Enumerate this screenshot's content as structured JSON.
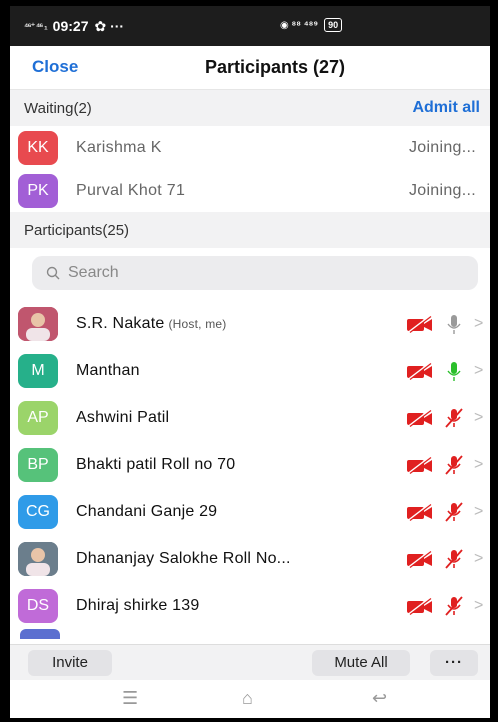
{
  "status": {
    "signal": "⁴⁶⁺ ⁴⁶ ₁",
    "time": "09:27",
    "extras": "✿ ···",
    "center_text": "◉ ⁸⁸ ⁴⁸⁹",
    "battery": "90"
  },
  "header": {
    "close_label": "Close",
    "title": "Participants (27)"
  },
  "waiting": {
    "label": "Waiting(2)",
    "admit_label": "Admit all",
    "items": [
      {
        "initials": "KK",
        "name": "Karishma K",
        "status": "Joining...",
        "color": "#e84a4f"
      },
      {
        "initials": "PK",
        "name": "Purval Khot 71",
        "status": "Joining...",
        "color": "#a25fd6"
      }
    ]
  },
  "participants": {
    "label": "Participants(25)",
    "search_placeholder": "Search",
    "items": [
      {
        "initials": "",
        "name": "S.R. Nakate",
        "tag": "(Host, me)",
        "photo": true,
        "photo_color": "#c0566e",
        "mic": "gray"
      },
      {
        "initials": "M",
        "name": "Manthan",
        "tag": "",
        "color": "#26b08a",
        "mic": "green"
      },
      {
        "initials": "AP",
        "name": "Ashwini Patil",
        "tag": "",
        "color": "#9bd46a",
        "mic": "muted"
      },
      {
        "initials": "BP",
        "name": "Bhakti patil Roll no 70",
        "tag": "",
        "color": "#56c27a",
        "mic": "muted"
      },
      {
        "initials": "CG",
        "name": "Chandani Ganje 29",
        "tag": "",
        "color": "#2f9be8",
        "mic": "muted"
      },
      {
        "initials": "",
        "name": "Dhananjay Salokhe Roll No...",
        "tag": "",
        "photo": true,
        "photo_color": "#6b7e8c",
        "mic": "muted"
      },
      {
        "initials": "DS",
        "name": "Dhiraj shirke 139",
        "tag": "",
        "color": "#c06bd8",
        "mic": "muted"
      }
    ]
  },
  "footer": {
    "invite_label": "Invite",
    "mute_all_label": "Mute All",
    "more_label": "···"
  },
  "navbar": {
    "menu_glyph": "☰",
    "home_glyph": "⌂",
    "back_glyph": "↩"
  },
  "colors": {
    "accent": "#1f6fd6",
    "video_off": "#e02020",
    "mic_off": "#e02020",
    "mic_on": "#2bbf2b"
  }
}
